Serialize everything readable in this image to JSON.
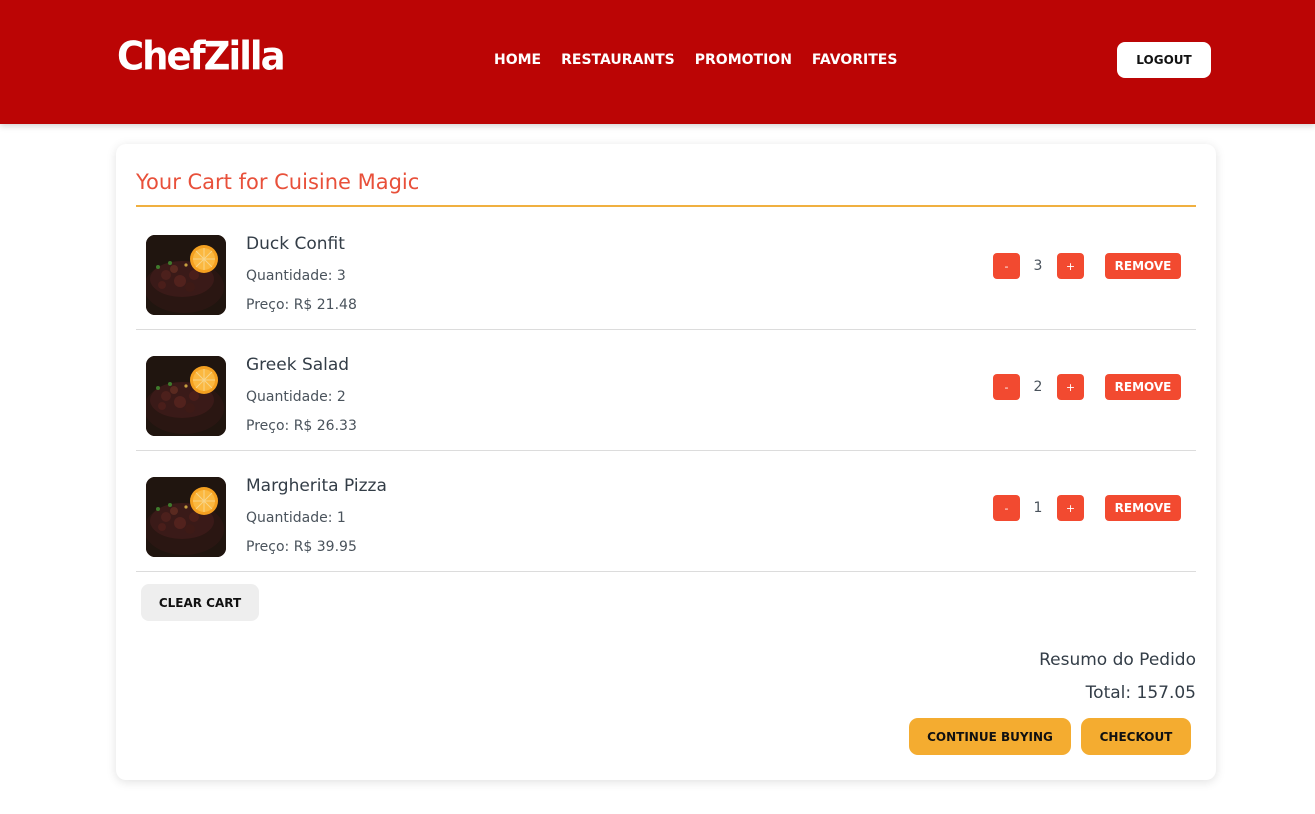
{
  "header": {
    "logo": "ChefZilla",
    "nav": [
      "HOME",
      "RESTAURANTS",
      "PROMOTION",
      "FAVORITES"
    ],
    "logout_label": "LOGOUT"
  },
  "cart": {
    "title": "Your Cart for Cuisine Magic",
    "items": [
      {
        "name": "Duck Confit",
        "quantity_text": "Quantidade: 3",
        "price_text": "Preço: R$ 21.48",
        "qty": "3",
        "image": "dish-photo"
      },
      {
        "name": "Greek Salad",
        "quantity_text": "Quantidade: 2",
        "price_text": "Preço: R$ 26.33",
        "qty": "2",
        "image": "dish-photo"
      },
      {
        "name": "Margherita Pizza",
        "quantity_text": "Quantidade: 1",
        "price_text": "Preço: R$ 39.95",
        "qty": "1",
        "image": "dish-photo"
      }
    ],
    "decrement_label": "-",
    "increment_label": "+",
    "remove_label": "REMOVE",
    "clear_label": "CLEAR CART"
  },
  "summary": {
    "title": "Resumo do Pedido",
    "total": "Total: 157.05",
    "continue_label": "CONTINUE BUYING",
    "checkout_label": "CHECKOUT"
  },
  "colors": {
    "header": "#bb0505",
    "accent_orange": "#f24a30",
    "title_text": "#e8503a",
    "rule": "#f0b040",
    "action_yellow": "#f4ac30"
  }
}
